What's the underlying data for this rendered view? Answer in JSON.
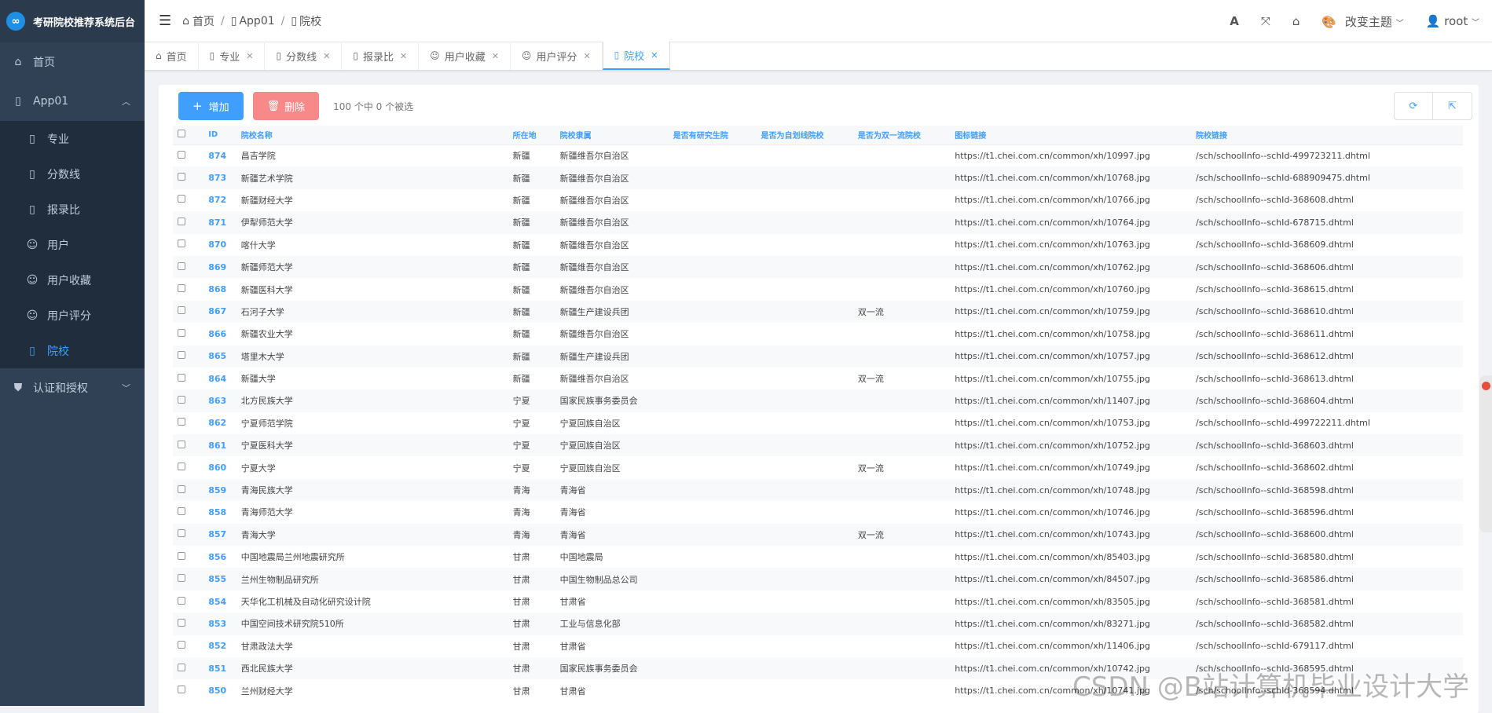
{
  "app": {
    "title": "考研院校推荐系统后台",
    "logo_glyph": "∞"
  },
  "sidebar": {
    "home": "首页",
    "app01": "App01",
    "subitems": [
      {
        "label": "专业",
        "icon": "file-icon"
      },
      {
        "label": "分数线",
        "icon": "file-icon"
      },
      {
        "label": "报录比",
        "icon": "file-icon"
      },
      {
        "label": "用户",
        "icon": "user-icon"
      },
      {
        "label": "用户收藏",
        "icon": "user-icon"
      },
      {
        "label": "用户评分",
        "icon": "user-icon"
      },
      {
        "label": "院校",
        "icon": "file-icon"
      }
    ],
    "auth": "认证和授权"
  },
  "header": {
    "breadcrumb": [
      "首页",
      "App01",
      "院校"
    ],
    "theme_label": "改变主题",
    "user": "root",
    "font_icon": "A"
  },
  "tabs": [
    {
      "label": "首页",
      "icon": "home-icon",
      "closable": false
    },
    {
      "label": "专业",
      "icon": "file-icon",
      "closable": true
    },
    {
      "label": "分数线",
      "icon": "file-icon",
      "closable": true
    },
    {
      "label": "报录比",
      "icon": "file-icon",
      "closable": true
    },
    {
      "label": "用户收藏",
      "icon": "user-icon",
      "closable": true
    },
    {
      "label": "用户评分",
      "icon": "user-icon",
      "closable": true
    },
    {
      "label": "院校",
      "icon": "file-icon",
      "closable": true,
      "active": true
    }
  ],
  "toolbar": {
    "add": "增加",
    "delete": "删除",
    "selection": "100 个中 0 个被选"
  },
  "table": {
    "headers": [
      "ID",
      "院校名称",
      "所在地",
      "院校隶属",
      "是否有研究生院",
      "是否为自划线院校",
      "是否为双一流院校",
      "图标链接",
      "院校链接"
    ],
    "rows": [
      [
        "874",
        "昌吉学院",
        "新疆",
        "新疆维吾尔自治区",
        "",
        "",
        "",
        "https://t1.chei.com.cn/common/xh/10997.jpg",
        "/sch/schoolInfo--schId-499723211.dhtml"
      ],
      [
        "873",
        "新疆艺术学院",
        "新疆",
        "新疆维吾尔自治区",
        "",
        "",
        "",
        "https://t1.chei.com.cn/common/xh/10768.jpg",
        "/sch/schoolInfo--schId-688909475.dhtml"
      ],
      [
        "872",
        "新疆财经大学",
        "新疆",
        "新疆维吾尔自治区",
        "",
        "",
        "",
        "https://t1.chei.com.cn/common/xh/10766.jpg",
        "/sch/schoolInfo--schId-368608.dhtml"
      ],
      [
        "871",
        "伊犁师范大学",
        "新疆",
        "新疆维吾尔自治区",
        "",
        "",
        "",
        "https://t1.chei.com.cn/common/xh/10764.jpg",
        "/sch/schoolInfo--schId-678715.dhtml"
      ],
      [
        "870",
        "喀什大学",
        "新疆",
        "新疆维吾尔自治区",
        "",
        "",
        "",
        "https://t1.chei.com.cn/common/xh/10763.jpg",
        "/sch/schoolInfo--schId-368609.dhtml"
      ],
      [
        "869",
        "新疆师范大学",
        "新疆",
        "新疆维吾尔自治区",
        "",
        "",
        "",
        "https://t1.chei.com.cn/common/xh/10762.jpg",
        "/sch/schoolInfo--schId-368606.dhtml"
      ],
      [
        "868",
        "新疆医科大学",
        "新疆",
        "新疆维吾尔自治区",
        "",
        "",
        "",
        "https://t1.chei.com.cn/common/xh/10760.jpg",
        "/sch/schoolInfo--schId-368615.dhtml"
      ],
      [
        "867",
        "石河子大学",
        "新疆",
        "新疆生产建设兵团",
        "",
        "",
        "双一流",
        "https://t1.chei.com.cn/common/xh/10759.jpg",
        "/sch/schoolInfo--schId-368610.dhtml"
      ],
      [
        "866",
        "新疆农业大学",
        "新疆",
        "新疆维吾尔自治区",
        "",
        "",
        "",
        "https://t1.chei.com.cn/common/xh/10758.jpg",
        "/sch/schoolInfo--schId-368611.dhtml"
      ],
      [
        "865",
        "塔里木大学",
        "新疆",
        "新疆生产建设兵团",
        "",
        "",
        "",
        "https://t1.chei.com.cn/common/xh/10757.jpg",
        "/sch/schoolInfo--schId-368612.dhtml"
      ],
      [
        "864",
        "新疆大学",
        "新疆",
        "新疆维吾尔自治区",
        "",
        "",
        "双一流",
        "https://t1.chei.com.cn/common/xh/10755.jpg",
        "/sch/schoolInfo--schId-368613.dhtml"
      ],
      [
        "863",
        "北方民族大学",
        "宁夏",
        "国家民族事务委员会",
        "",
        "",
        "",
        "https://t1.chei.com.cn/common/xh/11407.jpg",
        "/sch/schoolInfo--schId-368604.dhtml"
      ],
      [
        "862",
        "宁夏师范学院",
        "宁夏",
        "宁夏回族自治区",
        "",
        "",
        "",
        "https://t1.chei.com.cn/common/xh/10753.jpg",
        "/sch/schoolInfo--schId-499722211.dhtml"
      ],
      [
        "861",
        "宁夏医科大学",
        "宁夏",
        "宁夏回族自治区",
        "",
        "",
        "",
        "https://t1.chei.com.cn/common/xh/10752.jpg",
        "/sch/schoolInfo--schId-368603.dhtml"
      ],
      [
        "860",
        "宁夏大学",
        "宁夏",
        "宁夏回族自治区",
        "",
        "",
        "双一流",
        "https://t1.chei.com.cn/common/xh/10749.jpg",
        "/sch/schoolInfo--schId-368602.dhtml"
      ],
      [
        "859",
        "青海民族大学",
        "青海",
        "青海省",
        "",
        "",
        "",
        "https://t1.chei.com.cn/common/xh/10748.jpg",
        "/sch/schoolInfo--schId-368598.dhtml"
      ],
      [
        "858",
        "青海师范大学",
        "青海",
        "青海省",
        "",
        "",
        "",
        "https://t1.chei.com.cn/common/xh/10746.jpg",
        "/sch/schoolInfo--schId-368596.dhtml"
      ],
      [
        "857",
        "青海大学",
        "青海",
        "青海省",
        "",
        "",
        "双一流",
        "https://t1.chei.com.cn/common/xh/10743.jpg",
        "/sch/schoolInfo--schId-368600.dhtml"
      ],
      [
        "856",
        "中国地震局兰州地震研究所",
        "甘肃",
        "中国地震局",
        "",
        "",
        "",
        "https://t1.chei.com.cn/common/xh/85403.jpg",
        "/sch/schoolInfo--schId-368580.dhtml"
      ],
      [
        "855",
        "兰州生物制品研究所",
        "甘肃",
        "中国生物制品总公司",
        "",
        "",
        "",
        "https://t1.chei.com.cn/common/xh/84507.jpg",
        "/sch/schoolInfo--schId-368586.dhtml"
      ],
      [
        "854",
        "天华化工机械及自动化研究设计院",
        "甘肃",
        "甘肃省",
        "",
        "",
        "",
        "https://t1.chei.com.cn/common/xh/83505.jpg",
        "/sch/schoolInfo--schId-368581.dhtml"
      ],
      [
        "853",
        "中国空间技术研究院510所",
        "甘肃",
        "工业与信息化部",
        "",
        "",
        "",
        "https://t1.chei.com.cn/common/xh/83271.jpg",
        "/sch/schoolInfo--schId-368582.dhtml"
      ],
      [
        "852",
        "甘肃政法大学",
        "甘肃",
        "甘肃省",
        "",
        "",
        "",
        "https://t1.chei.com.cn/common/xh/11406.jpg",
        "/sch/schoolInfo--schId-679117.dhtml"
      ],
      [
        "851",
        "西北民族大学",
        "甘肃",
        "国家民族事务委员会",
        "",
        "",
        "",
        "https://t1.chei.com.cn/common/xh/10742.jpg",
        "/sch/schoolInfo--schId-368595.dhtml"
      ],
      [
        "850",
        "兰州财经大学",
        "甘肃",
        "甘肃省",
        "",
        "",
        "",
        "https://t1.chei.com.cn/common/xh/10741.jpg",
        "/sch/schoolInfo--schId-368594.dhtml"
      ]
    ]
  },
  "watermark": "CSDN @B站计算机毕业设计大学"
}
